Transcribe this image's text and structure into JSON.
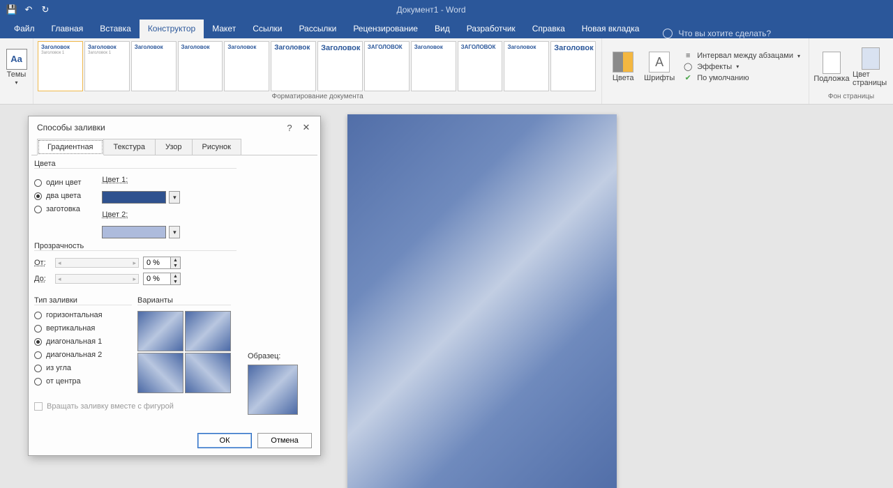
{
  "app": {
    "title": "Документ1  -  Word"
  },
  "tabs": {
    "file": "Файл",
    "home": "Главная",
    "insert": "Вставка",
    "design": "Конструктор",
    "layout": "Макет",
    "references": "Ссылки",
    "mailings": "Рассылки",
    "review": "Рецензирование",
    "view": "Вид",
    "developer": "Разработчик",
    "help": "Справка",
    "newtab": "Новая вкладка",
    "tellme": "Что вы хотите сделать?"
  },
  "ribbon": {
    "themes_label": "Темы",
    "docfmt_label": "Форматирование документа",
    "colors_label": "Цвета",
    "fonts_label": "Шрифты",
    "para_spacing": "Интервал между абзацами",
    "effects": "Эффекты",
    "default": "По умолчанию",
    "watermark": "Подложка",
    "page_color": "Цвет страницы",
    "page_bg_label": "Фон страницы",
    "thumb_heading": "Заголовок",
    "thumb_heading_up": "ЗАГОЛОВОК",
    "thumb_sub": "Заголовок 1"
  },
  "dialog": {
    "title": "Способы заливки",
    "tabs": {
      "gradient": "Градиентная",
      "texture": "Текстура",
      "pattern": "Узор",
      "picture": "Рисунок"
    },
    "colors_legend": "Цвета",
    "color_opts": {
      "one": "один цвет",
      "two": "два цвета",
      "preset": "заготовка"
    },
    "color1_label": "Цвет 1:",
    "color2_label": "Цвет 2:",
    "color1": "#2f528f",
    "color2": "#adbbdc",
    "transp_legend": "Прозрачность",
    "from": "От:",
    "to": "До:",
    "from_val": "0 %",
    "to_val": "0 %",
    "shading_legend": "Тип заливки",
    "shading": {
      "horiz": "горизонтальная",
      "vert": "вертикальная",
      "diag1": "диагональная 1",
      "diag2": "диагональная 2",
      "corner": "из угла",
      "center": "от центра"
    },
    "variants_legend": "Варианты",
    "sample_legend": "Образец:",
    "rotate_fill": "Вращать заливку вместе с фигурой",
    "ok": "ОК",
    "cancel": "Отмена"
  }
}
